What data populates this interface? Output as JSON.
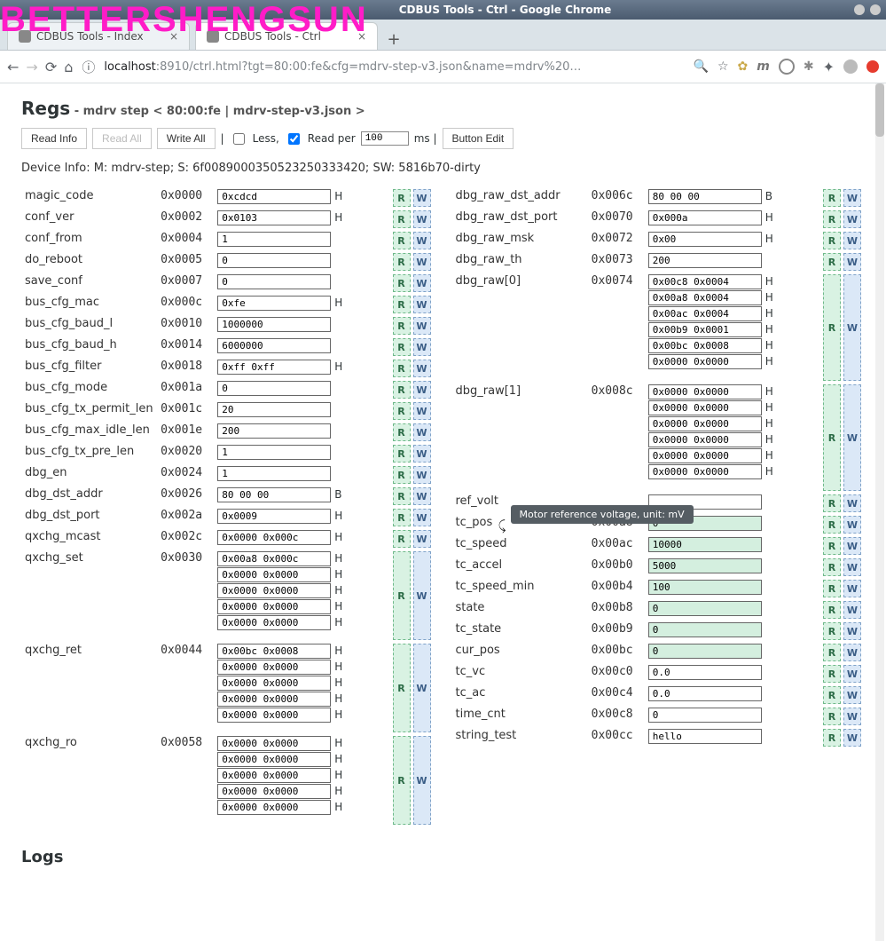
{
  "os_title": "CDBUS Tools - Ctrl - Google Chrome",
  "watermark": "BETTERSHENGSUN",
  "tabs": [
    {
      "label": "CDBUS Tools - Index",
      "active": false
    },
    {
      "label": "CDBUS Tools - Ctrl",
      "active": true
    }
  ],
  "url_host": "localhost",
  "url_rest": ":8910/ctrl.html?tgt=80:00:fe&cfg=mdrv-step-v3.json&name=mdrv%20…",
  "page_title": "Regs",
  "page_sub": " - mdrv step < 80:00:fe | mdrv-step-v3.json >",
  "toolbar": {
    "read_info": "Read Info",
    "read_all": "Read All",
    "write_all": "Write All",
    "less": "Less,",
    "read_per": "Read per",
    "read_per_val": "100",
    "ms": "ms |",
    "button_edit": "Button Edit"
  },
  "device_info": "Device Info: M: mdrv-step; S: 6f0089000350523250333420; SW: 5816b70-dirty",
  "tooltip": "Motor reference voltage, unit: mV",
  "logs_title": "Logs",
  "left": [
    {
      "name": "magic_code",
      "addr": "0x0000",
      "vals": [
        "0xcdcd"
      ],
      "fmt": "H"
    },
    {
      "name": "conf_ver",
      "addr": "0x0002",
      "vals": [
        "0x0103"
      ],
      "fmt": "H"
    },
    {
      "name": "conf_from",
      "addr": "0x0004",
      "vals": [
        "1"
      ],
      "fmt": ""
    },
    {
      "name": "do_reboot",
      "addr": "0x0005",
      "vals": [
        "0"
      ],
      "fmt": ""
    },
    {
      "name": "save_conf",
      "addr": "0x0007",
      "vals": [
        "0"
      ],
      "fmt": ""
    },
    {
      "name": "bus_cfg_mac",
      "addr": "0x000c",
      "vals": [
        "0xfe"
      ],
      "fmt": "H"
    },
    {
      "name": "bus_cfg_baud_l",
      "addr": "0x0010",
      "vals": [
        "1000000"
      ],
      "fmt": ""
    },
    {
      "name": "bus_cfg_baud_h",
      "addr": "0x0014",
      "vals": [
        "6000000"
      ],
      "fmt": ""
    },
    {
      "name": "bus_cfg_filter",
      "addr": "0x0018",
      "vals": [
        "0xff 0xff"
      ],
      "fmt": "H"
    },
    {
      "name": "bus_cfg_mode",
      "addr": "0x001a",
      "vals": [
        "0"
      ],
      "fmt": ""
    },
    {
      "name": "bus_cfg_tx_permit_len",
      "addr": "0x001c",
      "vals": [
        "20"
      ],
      "fmt": ""
    },
    {
      "name": "bus_cfg_max_idle_len",
      "addr": "0x001e",
      "vals": [
        "200"
      ],
      "fmt": ""
    },
    {
      "name": "bus_cfg_tx_pre_len",
      "addr": "0x0020",
      "vals": [
        "1"
      ],
      "fmt": ""
    },
    {
      "name": "dbg_en",
      "addr": "0x0024",
      "vals": [
        "1"
      ],
      "fmt": ""
    },
    {
      "name": "dbg_dst_addr",
      "addr": "0x0026",
      "vals": [
        "80 00 00"
      ],
      "fmt": "B"
    },
    {
      "name": "dbg_dst_port",
      "addr": "0x002a",
      "vals": [
        "0x0009"
      ],
      "fmt": "H"
    },
    {
      "name": "qxchg_mcast",
      "addr": "0x002c",
      "vals": [
        "0x0000 0x000c"
      ],
      "fmt": "H"
    },
    {
      "name": "qxchg_set",
      "addr": "0x0030",
      "vals": [
        "0x00a8 0x000c",
        "0x0000 0x0000",
        "0x0000 0x0000",
        "0x0000 0x0000",
        "0x0000 0x0000"
      ],
      "fmt": "H"
    },
    {
      "name": "qxchg_ret",
      "addr": "0x0044",
      "vals": [
        "0x00bc 0x0008",
        "0x0000 0x0000",
        "0x0000 0x0000",
        "0x0000 0x0000",
        "0x0000 0x0000"
      ],
      "fmt": "H"
    },
    {
      "name": "qxchg_ro",
      "addr": "0x0058",
      "vals": [
        "0x0000 0x0000",
        "0x0000 0x0000",
        "0x0000 0x0000",
        "0x0000 0x0000",
        "0x0000 0x0000"
      ],
      "fmt": "H"
    }
  ],
  "right": [
    {
      "name": "dbg_raw_dst_addr",
      "addr": "0x006c",
      "vals": [
        "80 00 00"
      ],
      "fmt": "B"
    },
    {
      "name": "dbg_raw_dst_port",
      "addr": "0x0070",
      "vals": [
        "0x000a"
      ],
      "fmt": "H"
    },
    {
      "name": "dbg_raw_msk",
      "addr": "0x0072",
      "vals": [
        "0x00"
      ],
      "fmt": "H"
    },
    {
      "name": "dbg_raw_th",
      "addr": "0x0073",
      "vals": [
        "200"
      ],
      "fmt": ""
    },
    {
      "name": "dbg_raw[0]",
      "addr": "0x0074",
      "vals": [
        "0x00c8 0x0004",
        "0x00a8 0x0004",
        "0x00ac 0x0004",
        "0x00b9 0x0001",
        "0x00bc 0x0008",
        "0x0000 0x0000"
      ],
      "fmt": "H"
    },
    {
      "name": "dbg_raw[1]",
      "addr": "0x008c",
      "vals": [
        "0x0000 0x0000",
        "0x0000 0x0000",
        "0x0000 0x0000",
        "0x0000 0x0000",
        "0x0000 0x0000",
        "0x0000 0x0000"
      ],
      "fmt": "H"
    },
    {
      "name": "ref_volt",
      "addr": "",
      "vals": [
        ""
      ],
      "fmt": "",
      "green": false,
      "tooltip": true
    },
    {
      "name": "tc_pos",
      "addr": "0x00a8",
      "vals": [
        "0"
      ],
      "fmt": "",
      "green": true
    },
    {
      "name": "tc_speed",
      "addr": "0x00ac",
      "vals": [
        "10000"
      ],
      "fmt": "",
      "green": true
    },
    {
      "name": "tc_accel",
      "addr": "0x00b0",
      "vals": [
        "5000"
      ],
      "fmt": "",
      "green": true
    },
    {
      "name": "tc_speed_min",
      "addr": "0x00b4",
      "vals": [
        "100"
      ],
      "fmt": "",
      "green": true
    },
    {
      "name": "state",
      "addr": "0x00b8",
      "vals": [
        "0"
      ],
      "fmt": "",
      "green": true
    },
    {
      "name": "tc_state",
      "addr": "0x00b9",
      "vals": [
        "0"
      ],
      "fmt": "",
      "green": true
    },
    {
      "name": "cur_pos",
      "addr": "0x00bc",
      "vals": [
        "0"
      ],
      "fmt": "",
      "green": true
    },
    {
      "name": "tc_vc",
      "addr": "0x00c0",
      "vals": [
        "0.0"
      ],
      "fmt": ""
    },
    {
      "name": "tc_ac",
      "addr": "0x00c4",
      "vals": [
        "0.0"
      ],
      "fmt": ""
    },
    {
      "name": "time_cnt",
      "addr": "0x00c8",
      "vals": [
        "0"
      ],
      "fmt": ""
    },
    {
      "name": "string_test",
      "addr": "0x00cc",
      "vals": [
        "hello"
      ],
      "fmt": ""
    }
  ]
}
